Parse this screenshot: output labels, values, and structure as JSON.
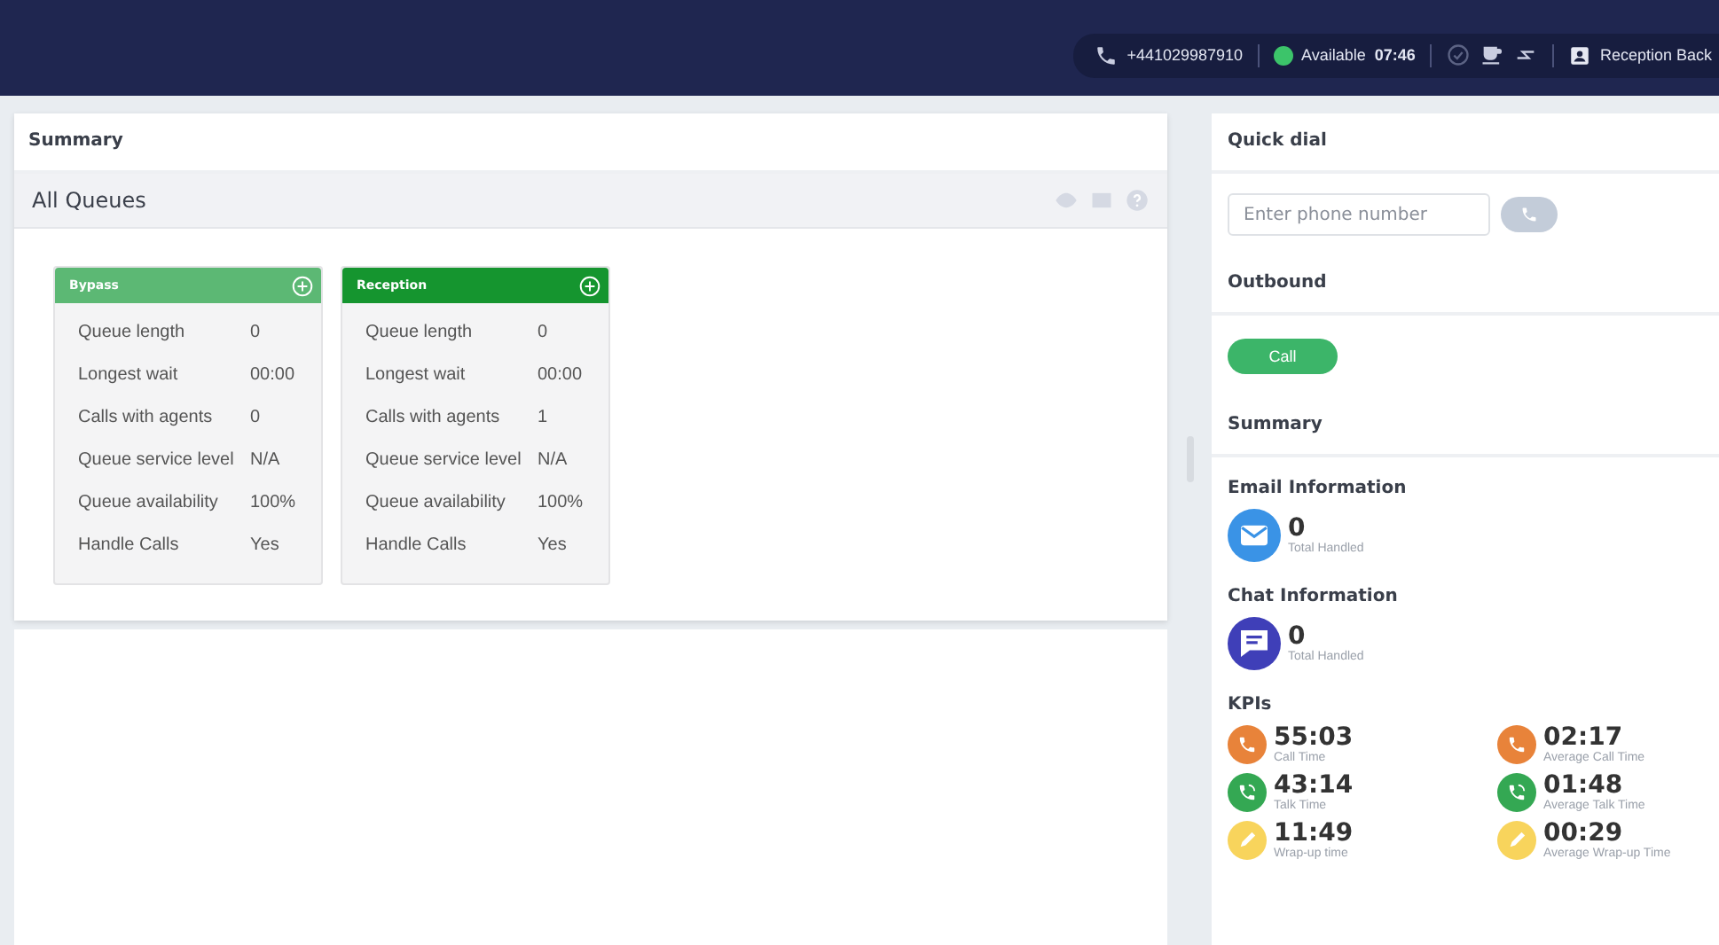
{
  "top_bar": {
    "phone": "+441029987910",
    "status": {
      "label": "Available",
      "time": "07:46",
      "color": "#3cc46a"
    },
    "queue": "Reception Back"
  },
  "summary_panel": {
    "title": "Summary"
  },
  "queues_panel": {
    "title": "All Queues",
    "queues": [
      {
        "name": "Bypass",
        "color": "#5cb874",
        "rows": [
          {
            "label": "Queue length",
            "value": "0"
          },
          {
            "label": "Longest wait",
            "value": "00:00"
          },
          {
            "label": "Calls with agents",
            "value": "0"
          },
          {
            "label": "Queue service level",
            "value": "N/A"
          },
          {
            "label": "Queue availability",
            "value": "100%"
          },
          {
            "label": "Handle Calls",
            "value": "Yes"
          }
        ]
      },
      {
        "name": "Reception",
        "color": "#15952f",
        "rows": [
          {
            "label": "Queue length",
            "value": "0"
          },
          {
            "label": "Longest wait",
            "value": "00:00"
          },
          {
            "label": "Calls with agents",
            "value": "1"
          },
          {
            "label": "Queue service level",
            "value": "N/A"
          },
          {
            "label": "Queue availability",
            "value": "100%"
          },
          {
            "label": "Handle Calls",
            "value": "Yes"
          }
        ]
      }
    ]
  },
  "quick_dial": {
    "title": "Quick dial",
    "placeholder": "Enter phone number"
  },
  "outbound": {
    "title": "Outbound",
    "button": "Call"
  },
  "summary": {
    "title": "Summary"
  },
  "channels": [
    {
      "kind": "email",
      "title": "Email Information",
      "count": "0",
      "caption": "Total Handled"
    },
    {
      "kind": "chat",
      "title": "Chat Information",
      "count": "0",
      "caption": "Total Handled"
    }
  ],
  "kpis": {
    "title": "KPIs",
    "items": [
      {
        "kind": "call",
        "color": "#e8833a",
        "value": "55:03",
        "caption": "Call Time"
      },
      {
        "kind": "call",
        "color": "#e8833a",
        "value": "02:17",
        "caption": "Average Call Time"
      },
      {
        "kind": "talk",
        "color": "#34a853",
        "value": "43:14",
        "caption": "Talk Time"
      },
      {
        "kind": "talk",
        "color": "#34a853",
        "value": "01:48",
        "caption": "Average Talk Time"
      },
      {
        "kind": "wrap",
        "color": "#f8d45c",
        "value": "11:49",
        "caption": "Wrap-up time"
      },
      {
        "kind": "wrap",
        "color": "#f8d45c",
        "value": "00:29",
        "caption": "Average Wrap-up Time"
      }
    ]
  }
}
